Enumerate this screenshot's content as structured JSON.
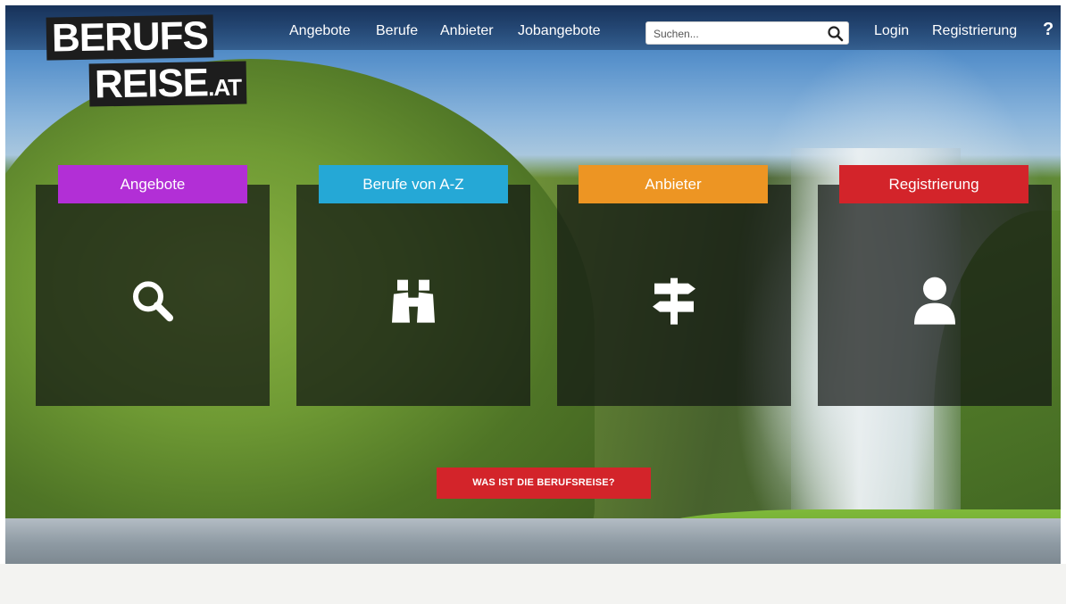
{
  "logo": {
    "line1": "BERUFS",
    "line2_main": "REISE",
    "line2_suffix": ".AT"
  },
  "nav": {
    "links": [
      "Angebote",
      "Berufe",
      "Anbieter",
      "Jobangebote"
    ],
    "search_placeholder": "Suchen...",
    "login": "Login",
    "register": "Registrierung",
    "help": "?"
  },
  "tiles": [
    {
      "label": "Angebote",
      "icon": "search-icon",
      "color": "#b22fd6"
    },
    {
      "label": "Berufe von A-Z",
      "icon": "binoculars-icon",
      "color": "#25a8d6"
    },
    {
      "label": "Anbieter",
      "icon": "signpost-icon",
      "color": "#ed9523"
    },
    {
      "label": "Registrierung",
      "icon": "user-icon",
      "color": "#d3242a"
    }
  ],
  "cta": {
    "label": "WAS IST DIE BERUFSREISE?",
    "color": "#d3242a"
  }
}
